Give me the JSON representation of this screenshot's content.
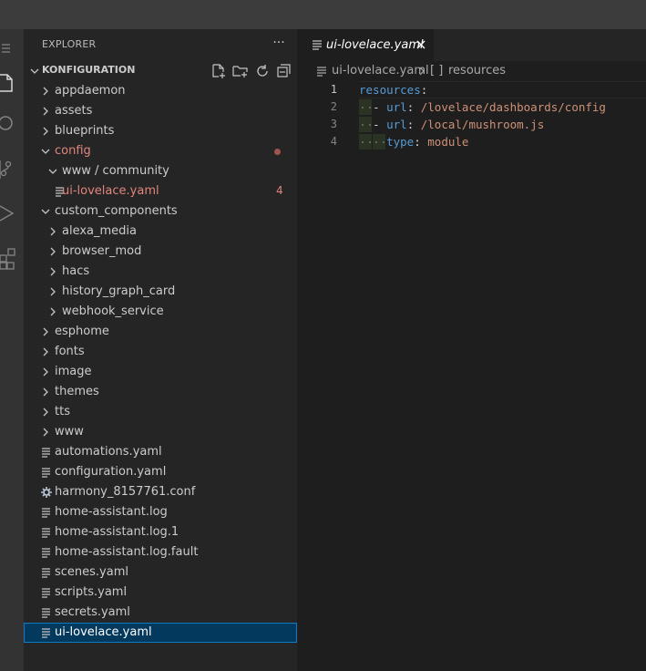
{
  "colors": {
    "accent": "#0e7ac4",
    "modified": "#e2857c",
    "selection": "#04395e",
    "yaml_key": "#569cd6",
    "yaml_value": "#ce9178"
  },
  "explorer": {
    "title": "EXPLORER",
    "more_icon": "ellipsis-icon",
    "folder": {
      "name": "KONFIGURATION",
      "actions": [
        "new-file-icon",
        "new-folder-icon",
        "refresh-icon",
        "collapse-all-icon"
      ]
    },
    "tree": [
      {
        "label": "appdaemon",
        "type": "folder",
        "expanded": false,
        "depth": 0
      },
      {
        "label": "assets",
        "type": "folder",
        "expanded": false,
        "depth": 0
      },
      {
        "label": "blueprints",
        "type": "folder",
        "expanded": false,
        "depth": 0
      },
      {
        "label": "config",
        "type": "folder",
        "expanded": true,
        "depth": 0,
        "modified": true,
        "dot": true
      },
      {
        "label": "www / community",
        "type": "folder",
        "expanded": true,
        "depth": 1
      },
      {
        "label": "ui-lovelace.yaml",
        "type": "file",
        "depth": 1,
        "modified": true,
        "badge": "4"
      },
      {
        "label": "custom_components",
        "type": "folder",
        "expanded": true,
        "depth": 0
      },
      {
        "label": "alexa_media",
        "type": "folder",
        "expanded": false,
        "depth": 1
      },
      {
        "label": "browser_mod",
        "type": "folder",
        "expanded": false,
        "depth": 1
      },
      {
        "label": "hacs",
        "type": "folder",
        "expanded": false,
        "depth": 1
      },
      {
        "label": "history_graph_card",
        "type": "folder",
        "expanded": false,
        "depth": 1
      },
      {
        "label": "webhook_service",
        "type": "folder",
        "expanded": false,
        "depth": 1
      },
      {
        "label": "esphome",
        "type": "folder",
        "expanded": false,
        "depth": 0
      },
      {
        "label": "fonts",
        "type": "folder",
        "expanded": false,
        "depth": 0
      },
      {
        "label": "image",
        "type": "folder",
        "expanded": false,
        "depth": 0
      },
      {
        "label": "themes",
        "type": "folder",
        "expanded": false,
        "depth": 0
      },
      {
        "label": "tts",
        "type": "folder",
        "expanded": false,
        "depth": 0
      },
      {
        "label": "www",
        "type": "folder",
        "expanded": false,
        "depth": 0
      },
      {
        "label": "automations.yaml",
        "type": "file",
        "depth": 0
      },
      {
        "label": "configuration.yaml",
        "type": "file",
        "depth": 0
      },
      {
        "label": "harmony_8157761.conf",
        "type": "gear",
        "depth": 0
      },
      {
        "label": "home-assistant.log",
        "type": "file",
        "depth": 0
      },
      {
        "label": "home-assistant.log.1",
        "type": "file",
        "depth": 0
      },
      {
        "label": "home-assistant.log.fault",
        "type": "file",
        "depth": 0
      },
      {
        "label": "scenes.yaml",
        "type": "file",
        "depth": 0
      },
      {
        "label": "scripts.yaml",
        "type": "file",
        "depth": 0
      },
      {
        "label": "secrets.yaml",
        "type": "file",
        "depth": 0
      },
      {
        "label": "ui-lovelace.yaml",
        "type": "file",
        "depth": 0,
        "selected": true
      }
    ]
  },
  "editor": {
    "tab": {
      "label": "ui-lovelace.yaml",
      "icon": "file-lines-icon",
      "close_icon": "close-icon"
    },
    "breadcrumb": {
      "file": "ui-lovelace.yaml",
      "symbol_icon": "[ ]",
      "symbol": "resources"
    },
    "lines": [
      {
        "number": "1",
        "indent": 0,
        "dash": false,
        "key": "resources",
        "value": ""
      },
      {
        "number": "2",
        "indent": 1,
        "dash": true,
        "key": "url",
        "value": "/lovelace/dashboards/config"
      },
      {
        "number": "3",
        "indent": 1,
        "dash": true,
        "key": "url",
        "value": "/local/mushroom.js"
      },
      {
        "number": "4",
        "indent": 2,
        "dash": false,
        "key": "type",
        "value": "module"
      }
    ]
  },
  "activity_bar": [
    "menu-icon",
    "files-icon",
    "search-icon",
    "source-control-icon",
    "run-debug-icon",
    "extensions-icon"
  ]
}
